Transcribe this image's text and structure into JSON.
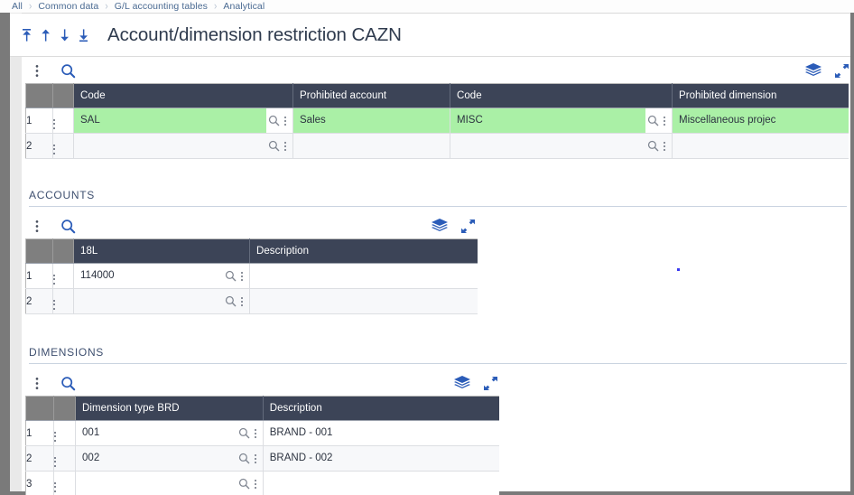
{
  "breadcrumb": {
    "items": [
      "All",
      "Common data",
      "G/L accounting tables",
      "Analytical"
    ],
    "separator": "›"
  },
  "titlebar": {
    "title": "Account/dimension restriction CAZN",
    "nav": [
      {
        "name": "first-record",
        "icon": "arrow-up-bar-icon"
      },
      {
        "name": "previous-record",
        "icon": "arrow-up-icon"
      },
      {
        "name": "next-record",
        "icon": "arrow-down-icon"
      },
      {
        "name": "last-record",
        "icon": "arrow-down-bar-icon"
      }
    ]
  },
  "toolbar_icons": {
    "kebab": "kebab-menu-icon",
    "search": "search-icon",
    "layers": "layers-icon",
    "expand": "expand-icon"
  },
  "grids": {
    "restriction": {
      "columns": [
        "Code",
        "Prohibited account",
        "Code",
        "Prohibited dimension"
      ],
      "rows": [
        {
          "num": "1",
          "cells": [
            {
              "value": "SAL",
              "highlight": true,
              "lookup": true
            },
            {
              "value": "Sales",
              "highlight": true,
              "lookup": false
            },
            {
              "value": "MISC",
              "highlight": true,
              "lookup": true
            },
            {
              "value": "Miscellaneous projec",
              "highlight": true,
              "lookup": false
            }
          ]
        },
        {
          "num": "2",
          "cells": [
            {
              "value": "",
              "highlight": false,
              "lookup": true
            },
            {
              "value": "",
              "highlight": false,
              "lookup": false
            },
            {
              "value": "",
              "highlight": false,
              "lookup": true
            },
            {
              "value": "",
              "highlight": false,
              "lookup": false
            }
          ]
        }
      ]
    },
    "accounts": {
      "label": "ACCOUNTS",
      "columns": [
        "18L",
        "Description"
      ],
      "rows": [
        {
          "num": "1",
          "cells": [
            {
              "value": "114000",
              "highlight": false,
              "lookup": true
            },
            {
              "value": "",
              "highlight": false,
              "lookup": false
            }
          ]
        },
        {
          "num": "2",
          "cells": [
            {
              "value": "",
              "highlight": false,
              "lookup": true
            },
            {
              "value": "",
              "highlight": false,
              "lookup": false
            }
          ]
        }
      ]
    },
    "dimensions": {
      "label": "DIMENSIONS",
      "columns": [
        "Dimension type BRD",
        "Description"
      ],
      "rows": [
        {
          "num": "1",
          "cells": [
            {
              "value": "001",
              "highlight": false,
              "lookup": true
            },
            {
              "value": "BRAND - 001",
              "highlight": false,
              "lookup": false
            }
          ]
        },
        {
          "num": "2",
          "cells": [
            {
              "value": "002",
              "highlight": false,
              "lookup": true
            },
            {
              "value": "BRAND - 002",
              "highlight": false,
              "lookup": false
            }
          ]
        },
        {
          "num": "3",
          "cells": [
            {
              "value": "",
              "highlight": false,
              "lookup": true
            },
            {
              "value": "",
              "highlight": false,
              "lookup": false
            }
          ]
        }
      ]
    }
  },
  "colors": {
    "header_bg": "#3c4457",
    "corner_bg": "#7f7f7f",
    "highlight": "#aaf0a6",
    "accent": "#2b5cb8",
    "breadcrumb_text": "#4a6a92"
  }
}
